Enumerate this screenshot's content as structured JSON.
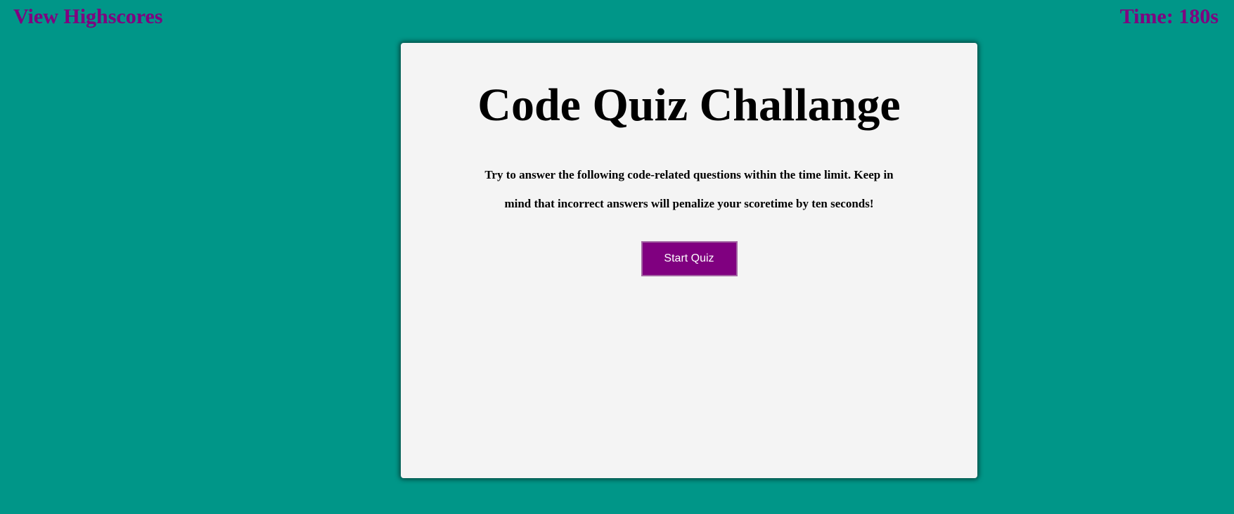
{
  "header": {
    "highscores_label": "View Highscores",
    "timer_text": "Time: 180s"
  },
  "quiz": {
    "title": "Code Quiz Challange",
    "instructions": "Try to answer the following code-related questions within the time limit. Keep in mind that incorrect answers will penalize your scoretime by ten seconds!",
    "start_button_label": "Start Quiz"
  },
  "colors": {
    "background": "#009688",
    "accent": "#800080",
    "card": "#f4f4f4"
  }
}
